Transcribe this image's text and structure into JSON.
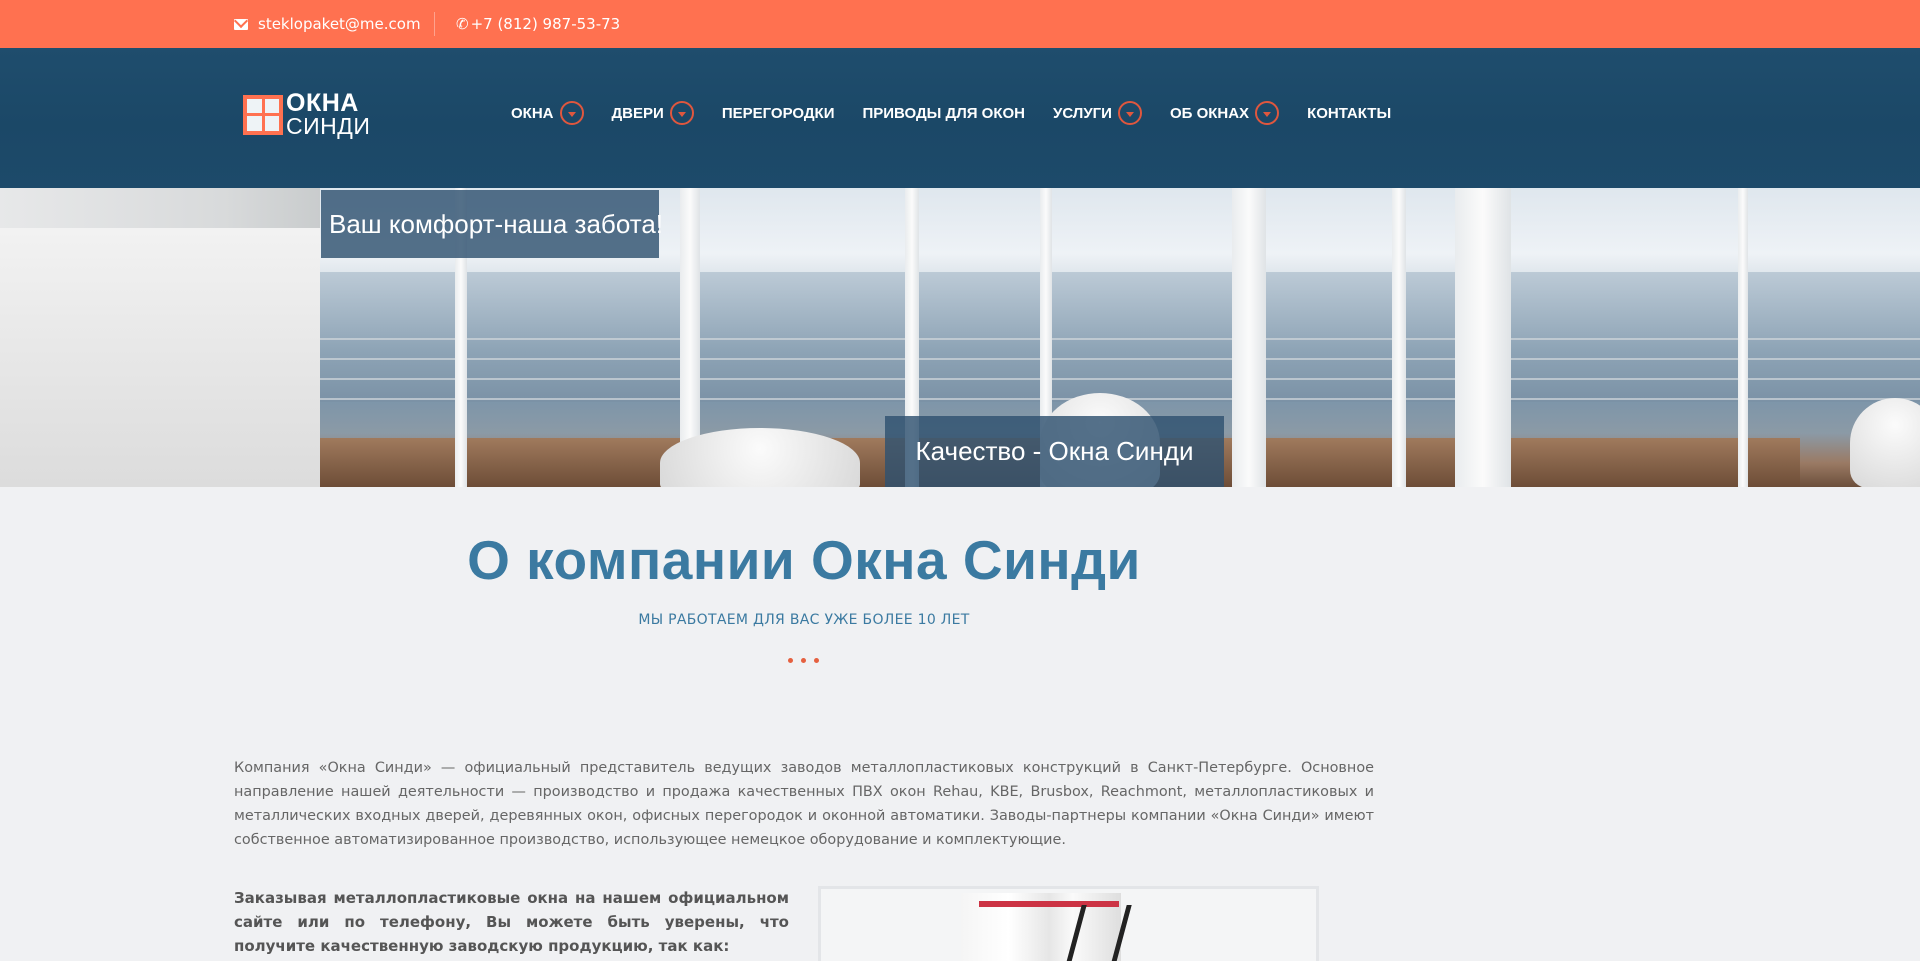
{
  "topbar": {
    "email": "steklopaket@me.com",
    "phone": "+7 (812) 987-53-73"
  },
  "logo": {
    "line1": "ОКНА",
    "line2": "СИНДИ"
  },
  "nav": {
    "items": [
      {
        "label": "ОКНА",
        "has_dropdown": true
      },
      {
        "label": "ДВЕРИ",
        "has_dropdown": true
      },
      {
        "label": "ПЕРЕГОРОДКИ",
        "has_dropdown": false
      },
      {
        "label": "ПРИВОДЫ ДЛЯ ОКОН",
        "has_dropdown": false
      },
      {
        "label": "УСЛУГИ",
        "has_dropdown": true
      },
      {
        "label": "ОБ ОКНАХ",
        "has_dropdown": true
      },
      {
        "label": "КОНТАКТЫ",
        "has_dropdown": false
      }
    ]
  },
  "hero": {
    "caption1": "Ваш комфорт-наша забота!",
    "caption2": "Качество - Окна Синди"
  },
  "about": {
    "title": "О компании Окна Синди",
    "subtitle": "МЫ РАБОТАЕМ ДЛЯ ВАС УЖЕ БОЛЕЕ 10 ЛЕТ",
    "paragraph": "Компания «Окна Синди» — официальный представитель ведущих заводов металлопластиковых конструкций в Санкт-Петербурге. Основное направление нашей деятельности — производство и продажа качественных ПВХ окон Rehau, KBE, Brusbox, Reachmont, металлопластиковых и металлических входных дверей, деревянных окон, офисных перегородок и оконной автоматики. Заводы-партнеры компании «Окна Синди» имеют собственное автоматизированное производство, использующее немецкое оборудование и комплектующие.",
    "paragraph2": "Заказывая металлопластиковые окна на нашем официальном сайте или по телефону, Вы можете быть уверены, что получите качественную заводскую продукцию, так как:"
  },
  "colors": {
    "accent": "#ff7150",
    "header_bg": "#1f4d6d",
    "title": "#3b7aa1"
  },
  "icons": {
    "email": "envelope-icon",
    "phone": "phone-icon",
    "dropdown": "chevron-down-icon"
  }
}
